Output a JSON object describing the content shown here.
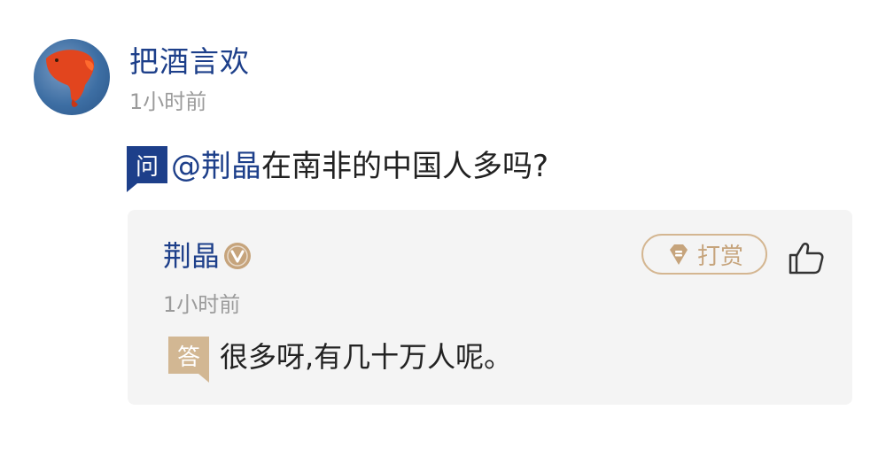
{
  "comment": {
    "user": {
      "name": "把酒言欢",
      "time": "1小时前",
      "avatar_icon": "red-fish-avatar"
    },
    "question": {
      "badge": "问",
      "mention": "@荆晶",
      "text": "在南非的中国人多吗?"
    },
    "answer": {
      "name": "荆晶",
      "verified_icon": "verified-v-badge-icon",
      "reward_label": "打赏",
      "reward_icon": "diamond-reward-icon",
      "like_icon": "thumbs-up-icon",
      "time": "1小时前",
      "badge": "答",
      "text": "很多呀,有几十万人呢。"
    }
  },
  "colors": {
    "name_blue": "#1d3f8a",
    "gold": "#c6a47c",
    "time_gray": "#9b9b9b",
    "card_bg": "#f4f4f4"
  }
}
